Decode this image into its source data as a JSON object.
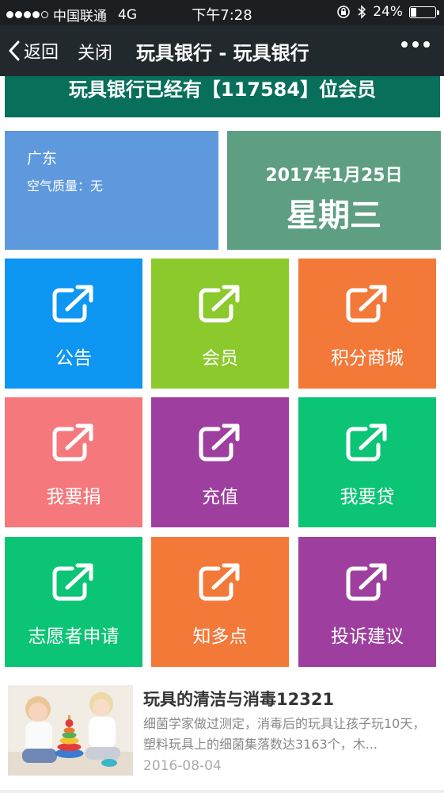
{
  "status_bar": {
    "carrier": "中国联通",
    "network": "4G",
    "time": "下午7:28",
    "battery": "24%",
    "battery_level": 0.24
  },
  "nav": {
    "back_label": "返回",
    "close_label": "关闭",
    "title": "玩具银行 - 玩具银行"
  },
  "banner": {
    "text": "玩具银行已经有【117584】位会员"
  },
  "weather": {
    "city": "广东",
    "air_quality": "空气质量：无"
  },
  "date_panel": {
    "date": "2017年1月25日",
    "weekday": "星期三"
  },
  "tiles": [
    {
      "label": "公告",
      "color": "#0e96f3"
    },
    {
      "label": "会员",
      "color": "#8bc92d"
    },
    {
      "label": "积分商城",
      "color": "#f37939"
    },
    {
      "label": "我要捐",
      "color": "#f5787c"
    },
    {
      "label": "充值",
      "color": "#9e3f9f"
    },
    {
      "label": "我要贷",
      "color": "#0cc475"
    },
    {
      "label": "志愿者申请",
      "color": "#0cc475"
    },
    {
      "label": "知多点",
      "color": "#f37939"
    },
    {
      "label": "投诉建议",
      "color": "#9e3f9f"
    }
  ],
  "article": {
    "title": "玩具的清洁与消毒12321",
    "description": "细菌学家做过测定，消毒后的玩具让孩子玩10天，塑料玩具上的细菌集落数达3163个，木...",
    "date": "2016-08-04"
  },
  "colors": {
    "status_bg": "#1c1f22",
    "nav_bg": "#22292d",
    "banner_bg": "#076f5a",
    "weather_bg": "#5f99dd",
    "date_bg": "#5e9e82"
  }
}
